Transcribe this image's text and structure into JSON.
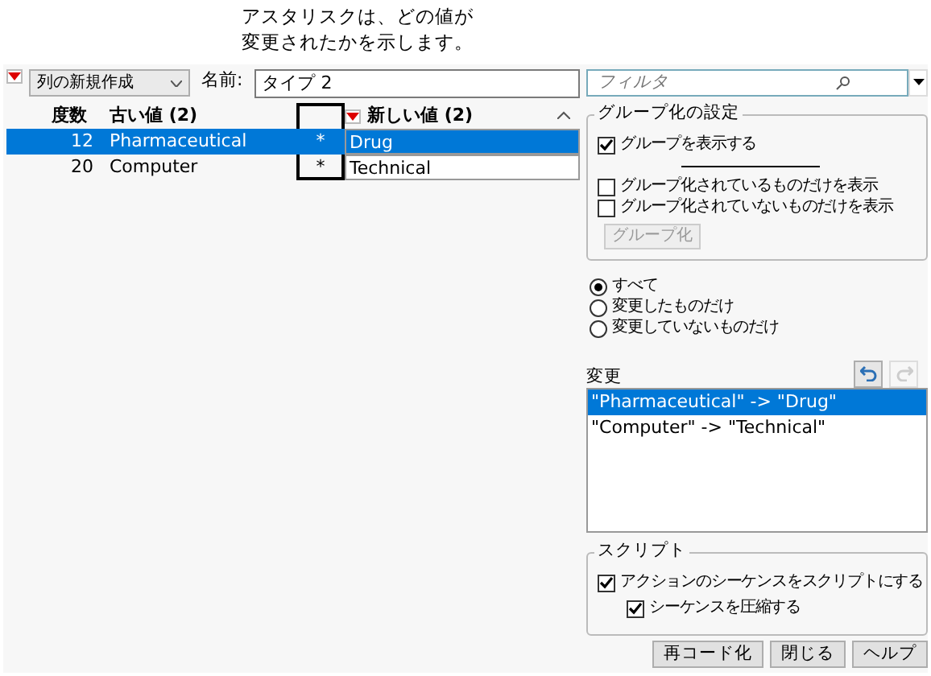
{
  "callout": [
    "アスタリスクは、どの値が",
    "変更されたかを示します。"
  ],
  "toolbar": {
    "new_column": "列の新規作成",
    "name_label": "名前:",
    "name_value": "タイプ 2"
  },
  "table": {
    "columns": {
      "count": "度数",
      "old": "古い値 (2)",
      "new": "新しい値 (2)"
    },
    "rows": [
      {
        "count": "12",
        "old": "Pharmaceutical",
        "mark": "*",
        "new": "Drug",
        "selected": true
      },
      {
        "count": "20",
        "old": "Computer",
        "mark": "*",
        "new": "Technical",
        "selected": false
      }
    ]
  },
  "filter": {
    "placeholder": "フィルタ"
  },
  "grouping": {
    "title": "グループ化の設定",
    "show_groups": {
      "label": "グループを表示する",
      "checked": true
    },
    "options": [
      {
        "label": "グループ化されているものだけを表示",
        "checked": false
      },
      {
        "label": "グループ化されていないものだけを表示",
        "checked": false
      }
    ],
    "button": {
      "label": "グループ化",
      "disabled": true
    }
  },
  "view": [
    {
      "label": "すべて",
      "selected": true
    },
    {
      "label": "変更したものだけ",
      "selected": false
    },
    {
      "label": "変更していないものだけ",
      "selected": false
    }
  ],
  "changes": {
    "title": "変更",
    "undo_enabled": true,
    "redo_enabled": false,
    "items": [
      {
        "text": "\"Pharmaceutical\" -> \"Drug\"",
        "selected": true
      },
      {
        "text": "\"Computer\" -> \"Technical\"",
        "selected": false
      }
    ]
  },
  "script": {
    "title": "スクリプト",
    "options": [
      {
        "label": "アクションのシーケンスをスクリプトにする",
        "checked": true,
        "children": [
          {
            "label": "シーケンスを圧縮する",
            "checked": true
          }
        ]
      }
    ]
  },
  "buttons": [
    "再コード化",
    "閉じる",
    "ヘルプ"
  ]
}
